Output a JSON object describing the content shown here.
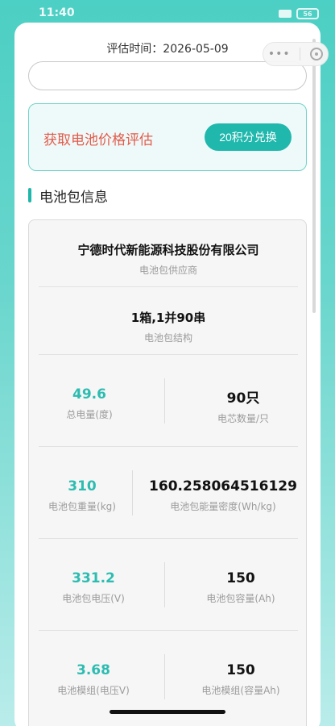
{
  "status_bar": {
    "time": "11:40",
    "battery": "56"
  },
  "header": {
    "eval_time": "评估时间：2026-05-09",
    "search_placeholder": ""
  },
  "price_box": {
    "title": "获取电池价格评估",
    "redeem_label": "20积分兑换"
  },
  "section": {
    "title": "电池包信息"
  },
  "info": {
    "supplier": {
      "value": "宁德时代新能源科技股份有限公司",
      "label": "电池包供应商"
    },
    "structure": {
      "value": "1箱,1并90串",
      "label": "电池包结构"
    },
    "total_power": {
      "value": "49.6",
      "label": "总电量(度)"
    },
    "cell_count": {
      "value": "90只",
      "label": "电芯数量/只"
    },
    "weight": {
      "value": "310",
      "label": "电池包重量(kg)"
    },
    "energy_density": {
      "value": "160.258064516129",
      "label": "电池包能量密度(Wh/kg)"
    },
    "voltage": {
      "value": "331.2",
      "label": "电池包电压(V)"
    },
    "capacity": {
      "value": "150",
      "label": "电池包容量(Ah)"
    },
    "module_voltage": {
      "value": "3.68",
      "label": "电池模组(电压V)"
    },
    "module_capacity": {
      "value": "150",
      "label": "电池模组(容量Ah)"
    }
  },
  "colors": {
    "accent": "#20b8ad",
    "warning_text": "#e35b4b",
    "value_teal": "#2dbcb1"
  },
  "icons": {
    "capsule_more": "more-dots-icon",
    "capsule_close": "close-miniprogram-icon"
  }
}
